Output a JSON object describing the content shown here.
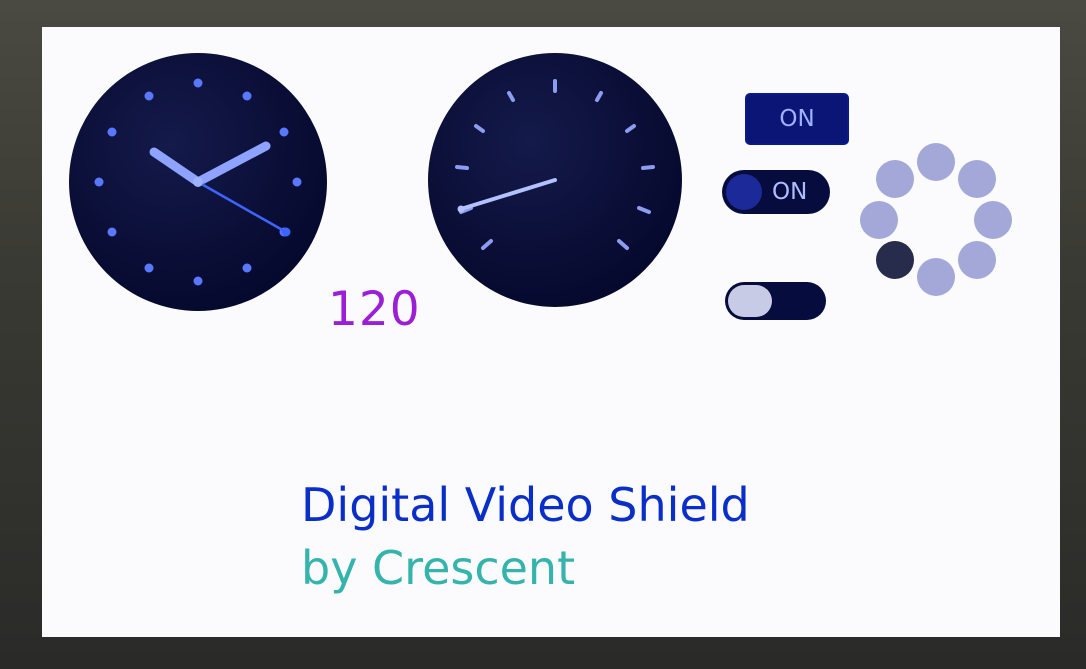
{
  "value_readout": "120",
  "button": {
    "label": "ON"
  },
  "toggle_primary": {
    "label": "ON",
    "state": "on"
  },
  "toggle_secondary": {
    "state": "off"
  },
  "spinner": {
    "dot_count": 8,
    "active_index": 5
  },
  "title": {
    "line1": "Digital Video Shield",
    "line2": "by Crescent"
  },
  "colors": {
    "dial_face": "#060b3a",
    "accent_blue": "#4f6cff",
    "readout_purple": "#9b1fd6",
    "title_blue": "#0a2fc8",
    "title_teal": "#35b3ad",
    "button_bg": "#0a1576",
    "spinner_dot": "#a3a8d8",
    "spinner_active": "#272b4c"
  }
}
